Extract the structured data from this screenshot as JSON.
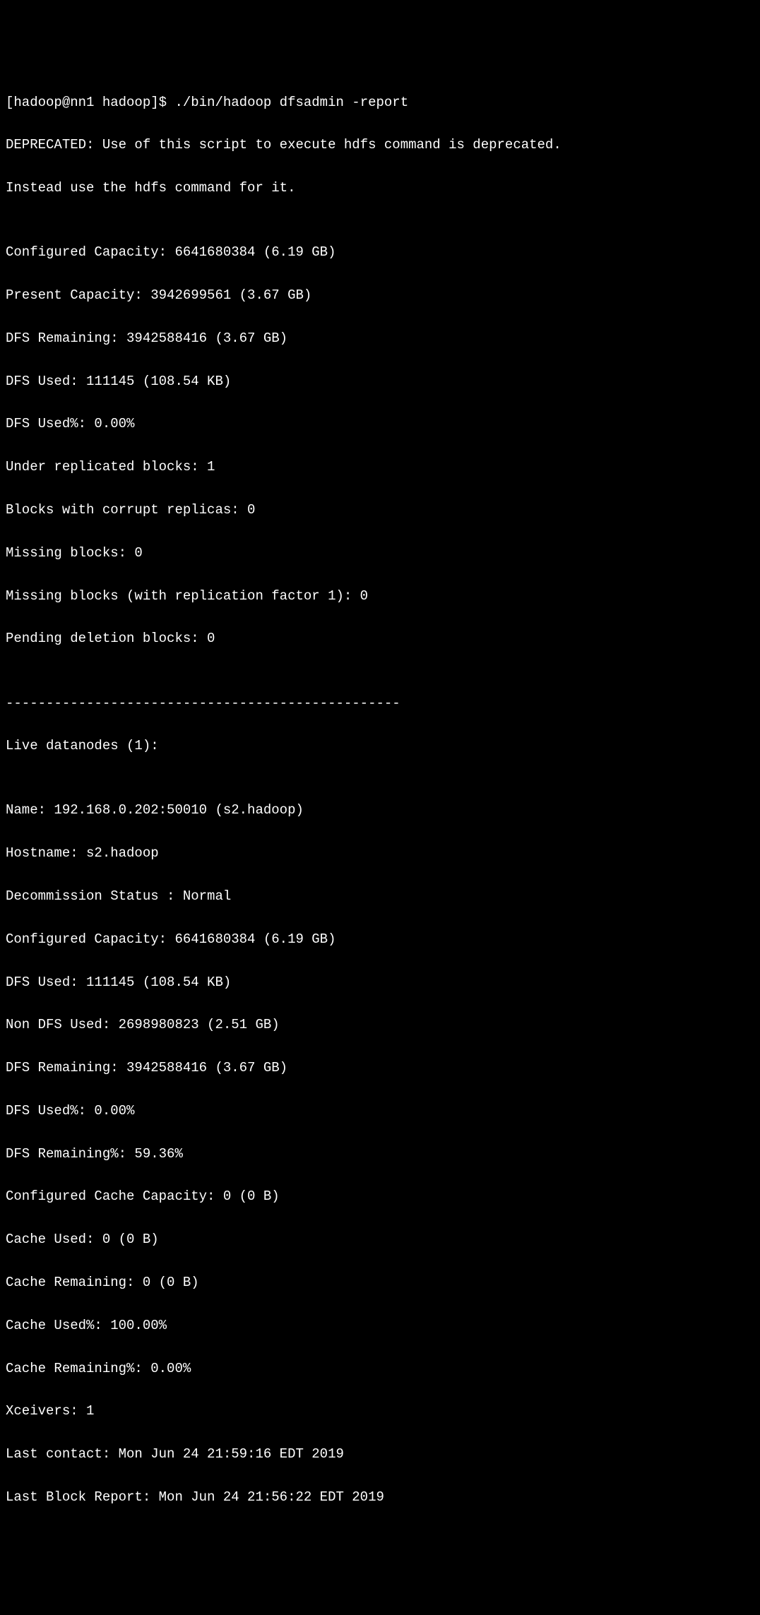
{
  "prompt": "[hadoop@nn1 hadoop]$ ",
  "command": "./bin/hadoop dfsadmin -report",
  "lines": {
    "deprecated1": "DEPRECATED: Use of this script to execute hdfs command is deprecated.",
    "deprecated2": "Instead use the hdfs command for it.",
    "blank1": "",
    "configuredCapacity": "Configured Capacity: 6641680384 (6.19 GB)",
    "presentCapacity": "Present Capacity: 3942699561 (3.67 GB)",
    "dfsRemaining": "DFS Remaining: 3942588416 (3.67 GB)",
    "dfsUsed": "DFS Used: 111145 (108.54 KB)",
    "dfsUsedPct": "DFS Used%: 0.00%",
    "underReplicated": "Under replicated blocks: 1",
    "corruptReplicas": "Blocks with corrupt replicas: 0",
    "missingBlocks": "Missing blocks: 0",
    "missingBlocksRf1": "Missing blocks (with replication factor 1): 0",
    "pendingDeletion": "Pending deletion blocks: 0",
    "blank2": "",
    "separator": "-------------------------------------------------",
    "liveDatanodes": "Live datanodes (1):",
    "blank3": "",
    "nodeName": "Name: 192.168.0.202:50010 (s2.hadoop)",
    "nodeHostname": "Hostname: s2.hadoop",
    "nodeDecommission": "Decommission Status : Normal",
    "nodeConfiguredCapacity": "Configured Capacity: 6641680384 (6.19 GB)",
    "nodeDfsUsed": "DFS Used: 111145 (108.54 KB)",
    "nodeNonDfsUsed": "Non DFS Used: 2698980823 (2.51 GB)",
    "nodeDfsRemaining": "DFS Remaining: 3942588416 (3.67 GB)",
    "nodeDfsUsedPct": "DFS Used%: 0.00%",
    "nodeDfsRemainingPct": "DFS Remaining%: 59.36%",
    "nodeCacheCapacity": "Configured Cache Capacity: 0 (0 B)",
    "nodeCacheUsed": "Cache Used: 0 (0 B)",
    "nodeCacheRemaining": "Cache Remaining: 0 (0 B)",
    "nodeCacheUsedPct": "Cache Used%: 100.00%",
    "nodeCacheRemainingPct": "Cache Remaining%: 0.00%",
    "nodeXceivers": "Xceivers: 1",
    "nodeLastContact": "Last contact: Mon Jun 24 21:59:16 EDT 2019",
    "nodeLastBlockReport": "Last Block Report: Mon Jun 24 21:56:22 EDT 2019"
  }
}
